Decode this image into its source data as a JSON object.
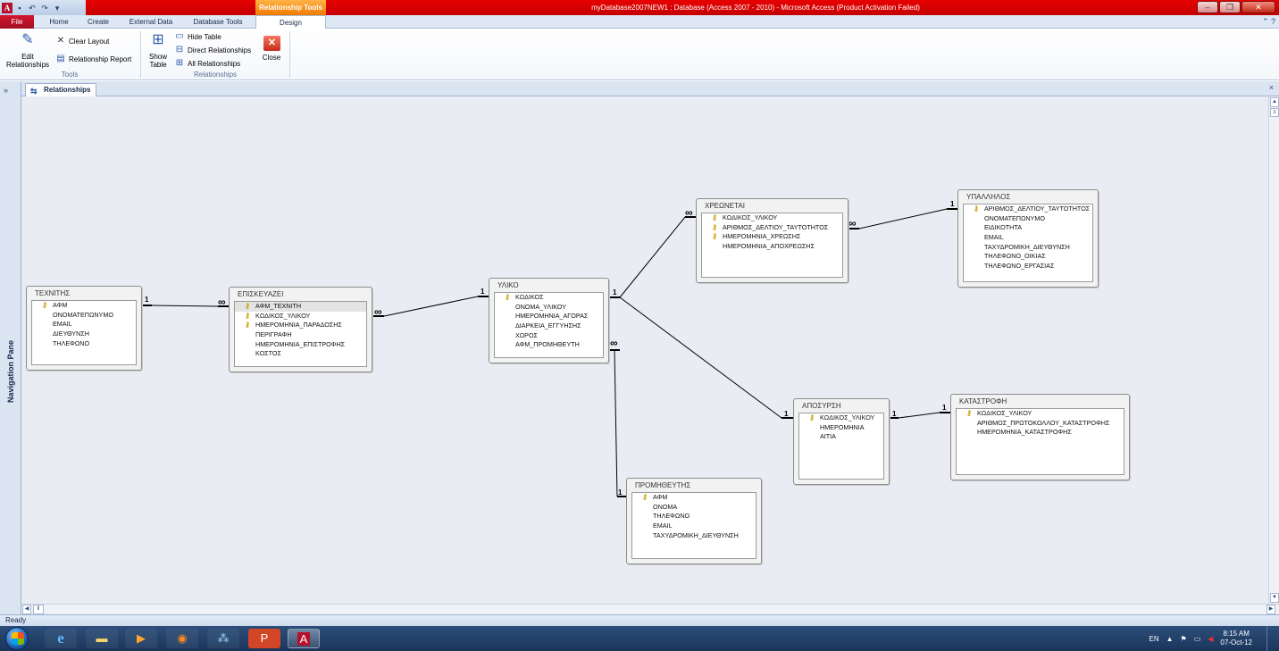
{
  "app": {
    "window_title": "myDatabase2007NEW1 : Database (Access 2007 - 2010)  -  Microsoft Access (Product Activation Failed)",
    "context_tab_group": "Relationship Tools"
  },
  "ribbon": {
    "tabs": [
      {
        "label": "File",
        "active": false
      },
      {
        "label": "Home",
        "active": false
      },
      {
        "label": "Create",
        "active": false
      },
      {
        "label": "External Data",
        "active": false
      },
      {
        "label": "Database Tools",
        "active": false
      },
      {
        "label": "Design",
        "active": true
      }
    ],
    "groups": {
      "tools": {
        "label": "Tools",
        "edit_relationships": "Edit Relationships",
        "clear_layout": "Clear Layout",
        "relationship_report": "Relationship Report"
      },
      "relationships": {
        "label": "Relationships",
        "show_table": "Show Table",
        "hide_table": "Hide Table",
        "direct_relationships": "Direct Relationships",
        "all_relationships": "All Relationships",
        "close": "Close"
      }
    }
  },
  "nav_pane": {
    "label": "Navigation Pane",
    "toggle": "»"
  },
  "document": {
    "tab_label": "Relationships",
    "close": "×"
  },
  "tables": {
    "technitis": {
      "title": "ΤΕΧΝΙΤΗΣ",
      "fields": [
        {
          "name": "ΑΦΜ",
          "key": true
        },
        {
          "name": "ΟΝΟΜΑΤΕΠΩΝΥΜΟ",
          "key": false
        },
        {
          "name": "EMAIL",
          "key": false
        },
        {
          "name": "ΔΙΕΥΘΥΝΣΗ",
          "key": false
        },
        {
          "name": "ΤΗΛΕΦΩΝΟ",
          "key": false
        }
      ]
    },
    "episkevazei": {
      "title": "ΕΠΙΣΚΕΥΑΖΕΙ",
      "fields": [
        {
          "name": "ΑΦΜ_ΤΕΧΝΙΤΗ",
          "key": true
        },
        {
          "name": "ΚΩΔΙΚΟΣ_ΥΛΙΚΟΥ",
          "key": true
        },
        {
          "name": "ΗΜΕΡΟΜΗΝΙΑ_ΠΑΡΑΔΟΣΗΣ",
          "key": true
        },
        {
          "name": "ΠΕΡΙΓΡΑΦΗ",
          "key": false
        },
        {
          "name": "ΗΜΕΡΟΜΗΝΙΑ_ΕΠΙΣΤΡΟΦΗΣ",
          "key": false
        },
        {
          "name": "ΚΟΣΤΟΣ",
          "key": false
        }
      ]
    },
    "yliko": {
      "title": "ΥΛΙΚΟ",
      "fields": [
        {
          "name": "ΚΩΔΙΚΟΣ",
          "key": true
        },
        {
          "name": "ΟΝΟΜΑ_ΥΛΙΚΟΥ",
          "key": false
        },
        {
          "name": "ΗΜΕΡΟΜΗΝΙΑ_ΑΓΟΡΑΣ",
          "key": false
        },
        {
          "name": "ΔΙΑΡΚΕΙΑ_ΕΓΓΥΗΣΗΣ",
          "key": false
        },
        {
          "name": "ΧΩΡΟΣ",
          "key": false
        },
        {
          "name": "ΑΦΜ_ΠΡΟΜΗΘΕΥΤΗ",
          "key": false
        }
      ]
    },
    "xreonetai": {
      "title": "ΧΡΕΩΝΕΤΑΙ",
      "fields": [
        {
          "name": "ΚΩΔΙΚΟΣ_ΥΛΙΚΟΥ",
          "key": true
        },
        {
          "name": "ΑΡΙΘΜΟΣ_ΔΕΛΤΙΟΥ_ΤΑΥΤΟΤΗΤΟΣ",
          "key": true
        },
        {
          "name": "ΗΜΕΡΟΜΗΝΙΑ_ΧΡΕΩΣΗΣ",
          "key": true
        },
        {
          "name": "ΗΜΕΡΟΜΗΝΙΑ_ΑΠΟΧΡΕΩΣΗΣ",
          "key": false
        }
      ]
    },
    "ypallilos": {
      "title": "ΥΠΑΛΛΗΛΟΣ",
      "fields": [
        {
          "name": "ΑΡΙΘΜΟΣ_ΔΕΛΤΙΟΥ_ΤΑΥΤΟΤΗΤΟΣ",
          "key": true
        },
        {
          "name": "ΟΝΟΜΑΤΕΠΩΝΥΜΟ",
          "key": false
        },
        {
          "name": "ΕΙΔΙΚΟΤΗΤΑ",
          "key": false
        },
        {
          "name": "EMAIL",
          "key": false
        },
        {
          "name": "ΤΑΧΥΔΡΟΜΙΚΗ_ΔΙΕΥΘΥΝΣΗ",
          "key": false
        },
        {
          "name": "ΤΗΛΕΦΩΝΟ_ΟΙΚΙΑΣ",
          "key": false
        },
        {
          "name": "ΤΗΛΕΦΩΝΟ_ΕΡΓΑΣΙΑΣ",
          "key": false
        }
      ]
    },
    "aposyrsi": {
      "title": "ΑΠΟΣΥΡΣΗ",
      "fields": [
        {
          "name": "ΚΩΔΙΚΟΣ_ΥΛΙΚΟΥ",
          "key": true
        },
        {
          "name": "ΗΜΕΡΟΜΗΝΙΑ",
          "key": false
        },
        {
          "name": "ΑΙΤΙΑ",
          "key": false
        }
      ]
    },
    "katastrofi": {
      "title": "ΚΑΤΑΣΤΡΟΦΗ",
      "fields": [
        {
          "name": "ΚΩΔΙΚΟΣ_ΥΛΙΚΟΥ",
          "key": true
        },
        {
          "name": "ΑΡΙΘΜΟΣ_ΠΡΩΤΟΚΟΛΛΟΥ_ΚΑΤΑΣΤΡΟΦΗΣ",
          "key": false
        },
        {
          "name": "ΗΜΕΡΟΜΗΝΙΑ_ΚΑΤΑΣΤΡΟΦΗΣ",
          "key": false
        }
      ]
    },
    "promitheftis": {
      "title": "ΠΡΟΜΗΘΕΥΤΗΣ",
      "fields": [
        {
          "name": "ΑΦΜ",
          "key": true
        },
        {
          "name": "ΟΝΟΜΑ",
          "key": false
        },
        {
          "name": "ΤΗΛΕΦΩΝΟ",
          "key": false
        },
        {
          "name": "EMAIL",
          "key": false
        },
        {
          "name": "ΤΑΧΥΔΡΟΜΙΚΗ_ΔΙΕΥΘΥΝΣΗ",
          "key": false
        }
      ]
    }
  },
  "relationships": [
    {
      "from": "technitis",
      "to": "episkevazei",
      "from_label": "1",
      "to_label": "∞"
    },
    {
      "from": "yliko",
      "to": "episkevazei",
      "from_label": "1",
      "to_label": "∞"
    },
    {
      "from": "yliko",
      "to": "xreonetai",
      "from_label": "1",
      "to_label": "∞"
    },
    {
      "from": "ypallilos",
      "to": "xreonetai",
      "from_label": "1",
      "to_label": "∞"
    },
    {
      "from": "yliko",
      "to": "aposyrsi",
      "from_label": "1",
      "to_label": "1"
    },
    {
      "from": "katastrofi",
      "to": "aposyrsi",
      "from_label": "1",
      "to_label": "1"
    },
    {
      "from": "promitheftis",
      "to": "yliko",
      "from_label": "1",
      "to_label": "∞"
    }
  ],
  "status": {
    "text": "Ready"
  },
  "taskbar": {
    "apps": [
      "internet-explorer",
      "windows-explorer",
      "media-player",
      "firefox",
      "network",
      "powerpoint",
      "access"
    ],
    "language": "EN",
    "time": "8:15 AM",
    "date": "07-Oct-12"
  },
  "colors": {
    "title_red": "#d40000",
    "context_orange": "#f07a00",
    "canvas_bg": "#e9edf3",
    "taskbar": "#1b355a"
  }
}
